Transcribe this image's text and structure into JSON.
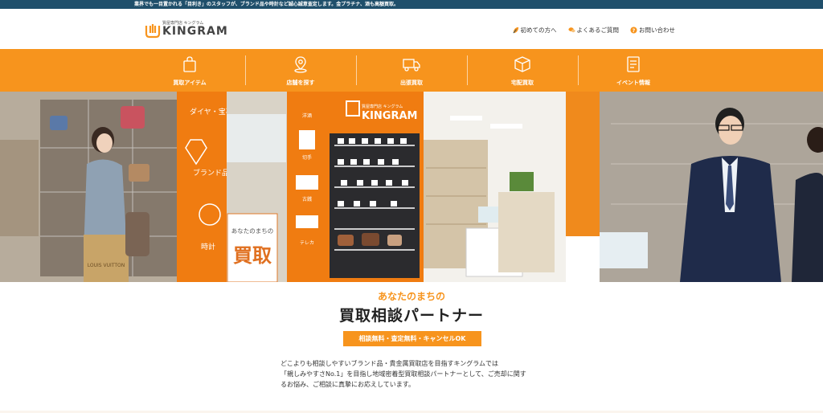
{
  "topbar": {
    "text": "業界でも一目置かれる「目利き」のスタッフが、ブランド品や時計など誠心誠意査定します。金プラチナ、酒も高額買取。"
  },
  "logo": {
    "small": "質屋専門店 キングラム",
    "name": "KINGRAM"
  },
  "header_nav": [
    {
      "label": "初めての方へ",
      "icon": "leaf-icon"
    },
    {
      "label": "よくあるご質問",
      "icon": "chat-icon"
    },
    {
      "label": "お問い合わせ",
      "icon": "question-icon"
    }
  ],
  "main_nav": [
    {
      "label": "買取アイテム",
      "icon": "bag-icon"
    },
    {
      "label": "店舗を探す",
      "icon": "map-pin-icon"
    },
    {
      "label": "出張買取",
      "icon": "truck-icon"
    },
    {
      "label": "宅配買取",
      "icon": "box-icon"
    },
    {
      "label": "イベント情報",
      "icon": "document-icon"
    }
  ],
  "hero": {
    "panel_labels": [
      "ダイヤ・宝石",
      "ブランド品",
      "時計"
    ],
    "store_sign_small": "質屋専門店 キングラム",
    "store_sign": "KINGRAM",
    "stand_text": "あなたのまちの",
    "stand_big": "買取",
    "shopping_bag": "LOUIS VUITTON",
    "column_labels": [
      "洋酒",
      "切手",
      "古銭",
      "テレカ"
    ]
  },
  "intro": {
    "sub_heading": "あなたのまちの",
    "heading": "買取相談パートナー",
    "badge": "相談無料・査定無料・キャンセルOK",
    "description": [
      "どこよりも相談しやすいブランド品・貴金属買取店を目指すキングラムでは",
      "「親しみやすさNo.1」を目指し地域密着型買取相談パートナーとして、ご売却に関す",
      "るお悩み、ご相談に真摯にお応えしています。"
    ]
  },
  "colors": {
    "brand_orange": "#f7941d",
    "topbar": "#1f4f6b"
  }
}
